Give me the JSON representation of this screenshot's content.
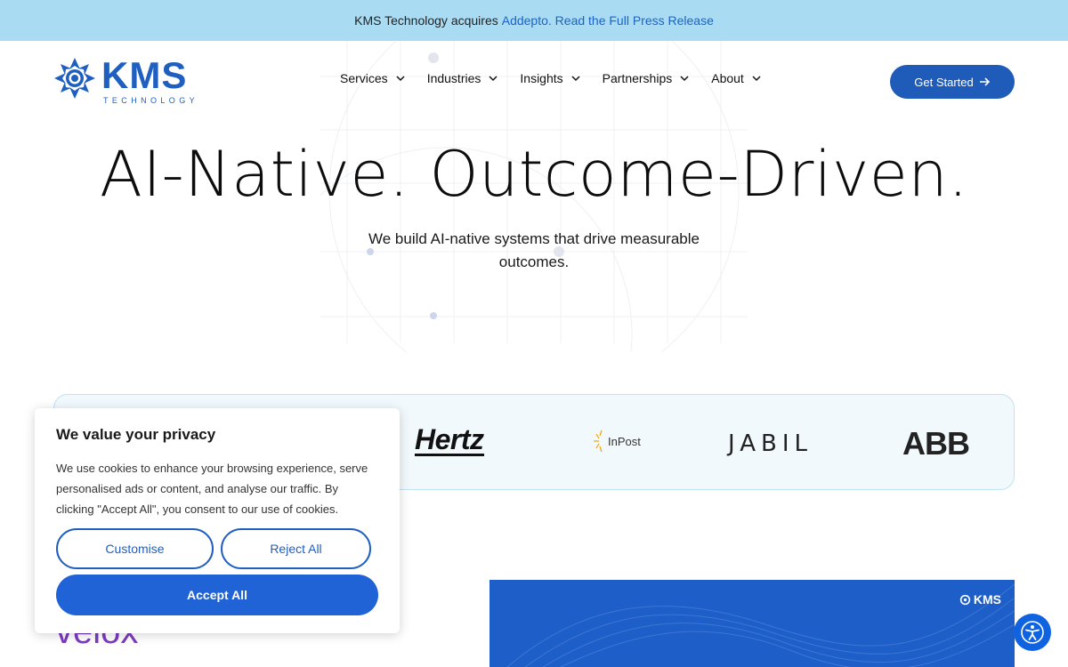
{
  "banner": {
    "text": "KMS Technology acquires",
    "link_text": "Addepto. Read the Full Press Release"
  },
  "logo": {
    "word": "KMS",
    "sub": "TECHNOLOGY"
  },
  "nav": {
    "items": [
      {
        "label": "Services"
      },
      {
        "label": "Industries"
      },
      {
        "label": "Insights"
      },
      {
        "label": "Partnerships"
      },
      {
        "label": "About"
      }
    ]
  },
  "cta": {
    "label": "Get Started"
  },
  "hero": {
    "title": "AI-Native. Outcome-Driven.",
    "subtitle": "We build AI-native systems that drive measurable outcomes."
  },
  "clients": {
    "logos": [
      {
        "name": "Hertz"
      },
      {
        "name": "InPost"
      },
      {
        "name": "JABIL"
      },
      {
        "name": "ABB"
      }
    ]
  },
  "velox": {
    "text": "velox"
  },
  "feature": {
    "logo_word": "KMS"
  },
  "cookie": {
    "title": "We value your privacy",
    "text": "We use cookies to enhance your browsing experience, serve personalised ads or content, and analyse our traffic. By clicking \"Accept All\", you consent to our use of cookies.",
    "customise_label": "Customise",
    "reject_label": "Reject All",
    "accept_label": "Accept All"
  },
  "colors": {
    "brand": "#1f5fbf",
    "banner_bg": "#a9dcf3",
    "accept": "#1f63d6",
    "feature_bg": "#1e5ec8"
  },
  "icons": {
    "dropdown": "chevron-down-icon",
    "cta_arrow": "arrow-right-icon",
    "accessibility": "accessibility-icon"
  }
}
